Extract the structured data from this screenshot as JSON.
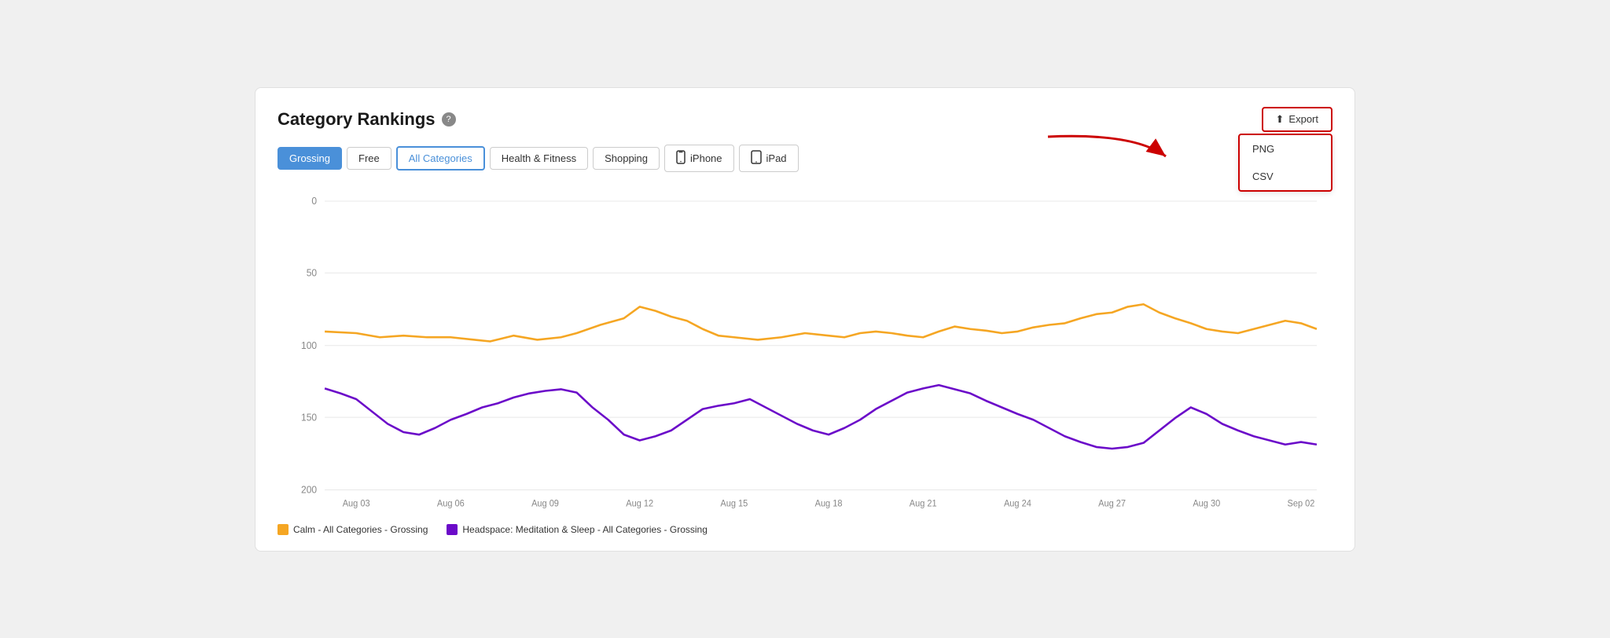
{
  "title": "Category Rankings",
  "toolbar": {
    "buttons": [
      {
        "id": "grossing",
        "label": "Grossing",
        "state": "active-blue"
      },
      {
        "id": "free",
        "label": "Free",
        "state": "normal"
      },
      {
        "id": "all-categories",
        "label": "All Categories",
        "state": "active-outline"
      },
      {
        "id": "health-fitness",
        "label": "Health & Fitness",
        "state": "normal"
      },
      {
        "id": "shopping",
        "label": "Shopping",
        "state": "normal"
      },
      {
        "id": "iphone",
        "label": "iPhone",
        "state": "device",
        "icon": "📱"
      },
      {
        "id": "ipad",
        "label": "iPad",
        "state": "device",
        "icon": "📋"
      }
    ]
  },
  "export": {
    "label": "Export",
    "options": [
      "PNG",
      "CSV"
    ]
  },
  "chart": {
    "yLabels": [
      "0",
      "50",
      "100",
      "150",
      "200"
    ],
    "xLabels": [
      "Aug 03",
      "Aug 06",
      "Aug 09",
      "Aug 12",
      "Aug 15",
      "Aug 18",
      "Aug 21",
      "Aug 24",
      "Aug 27",
      "Aug 30",
      "Sep 02"
    ]
  },
  "legend": [
    {
      "id": "calm",
      "color": "#f5a623",
      "label": "Calm - All Categories - Grossing"
    },
    {
      "id": "headspace",
      "color": "#6b0ac9",
      "label": "Headspace: Meditation & Sleep - All Categories - Grossing"
    }
  ]
}
